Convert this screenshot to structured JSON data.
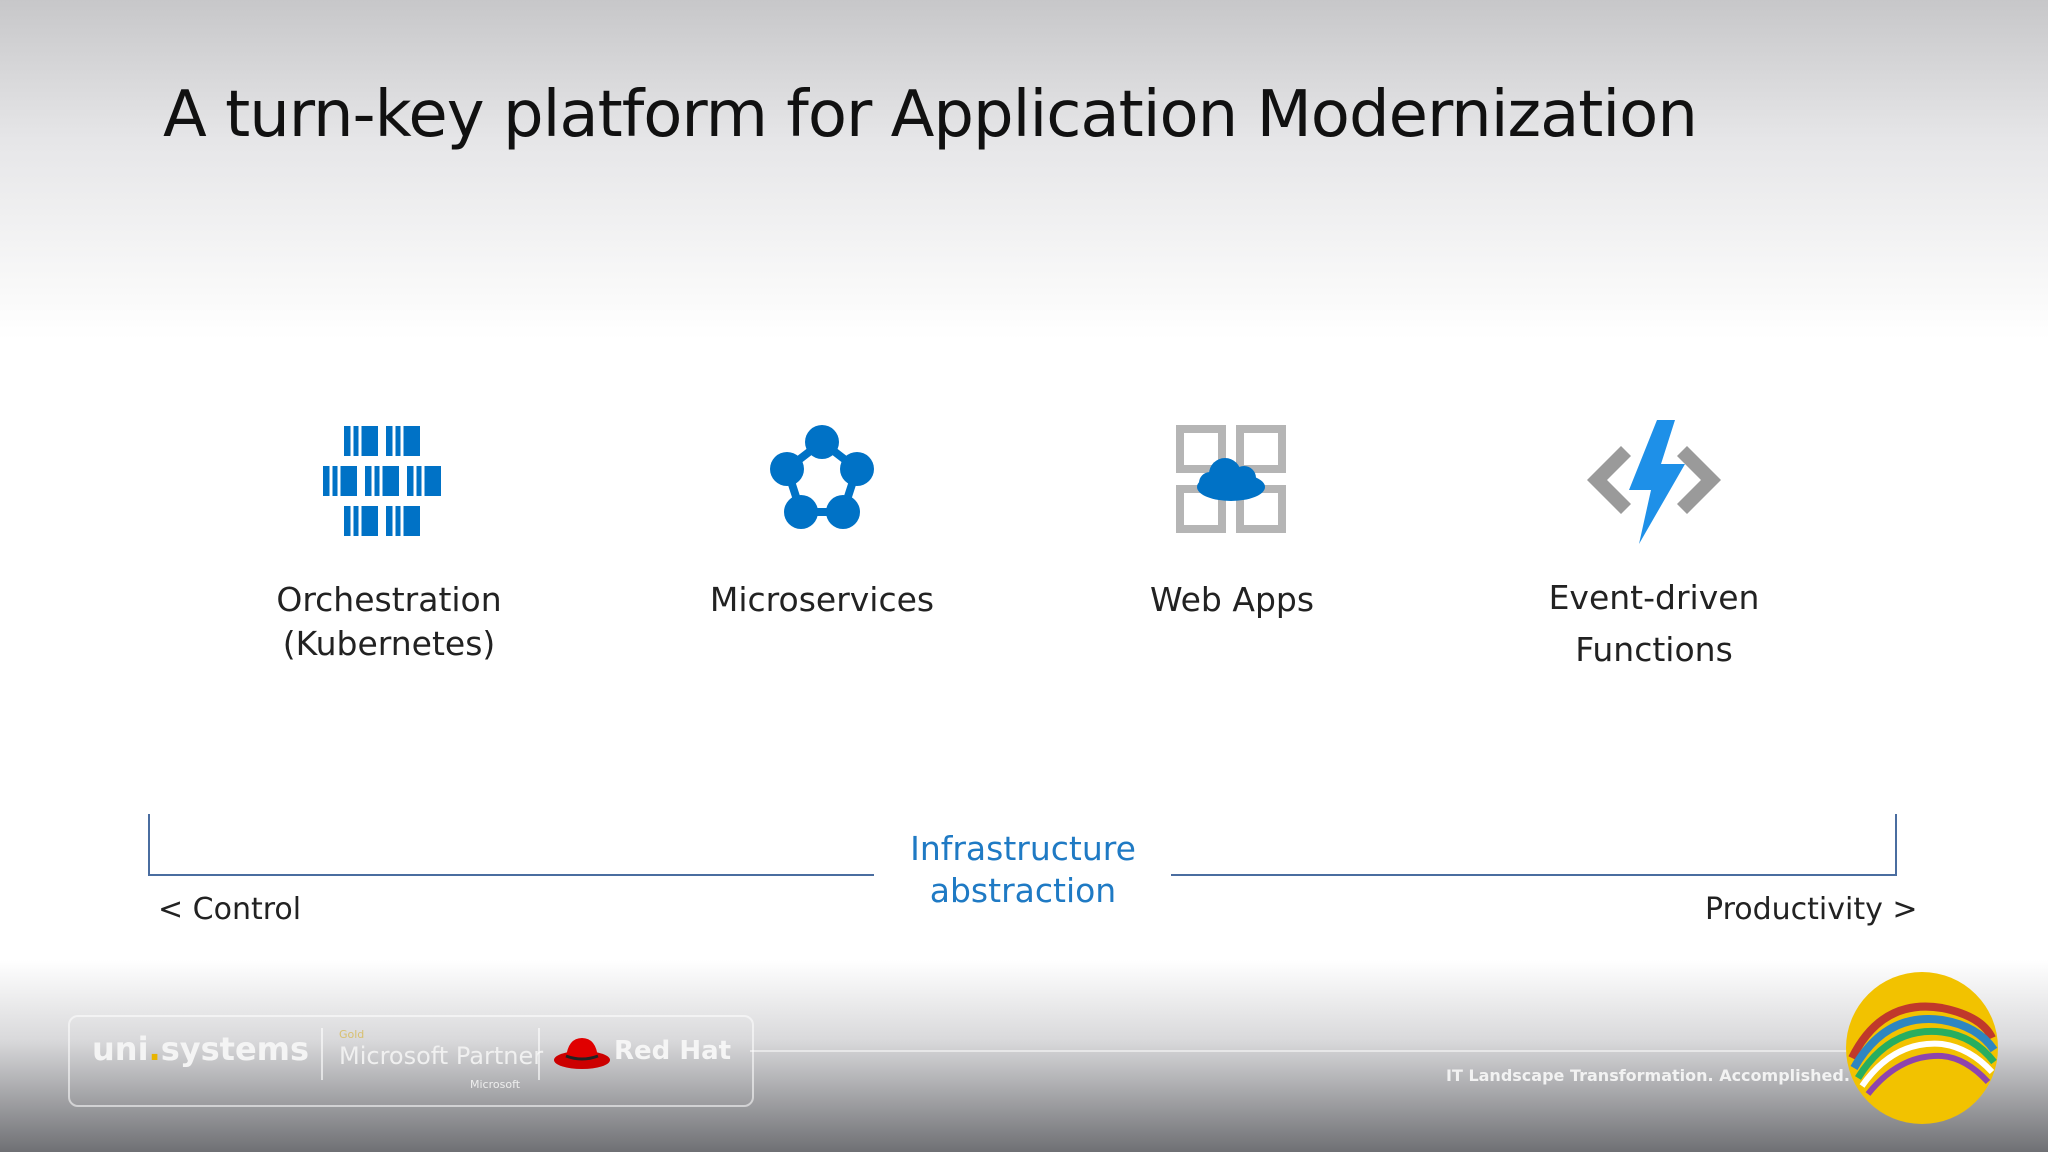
{
  "slide": {
    "title": "A turn-key platform for Application Modernization"
  },
  "features": [
    {
      "label_line1": "Orchestration",
      "label_line2": "(Kubernetes)",
      "icon": "kubernetes-containers-icon"
    },
    {
      "label_line1": "Microservices",
      "label_line2": "",
      "icon": "microservices-network-icon"
    },
    {
      "label_line1": "Web Apps",
      "label_line2": "",
      "icon": "web-app-cloud-icon"
    },
    {
      "label_line1": "Event-driven",
      "label_line2": "Functions",
      "icon": "functions-lightning-icon"
    }
  ],
  "axis": {
    "center_line1": "Infrastructure",
    "center_line2": "abstraction",
    "left_label": "< Control",
    "right_label": "Productivity >"
  },
  "footer": {
    "company": "uni",
    "company_suffix": "systems",
    "partner_level": "Gold",
    "partner_name": "Microsoft Partner",
    "partner_small": "Microsoft",
    "redhat": "Red Hat",
    "tagline": "IT Landscape Transformation. Accomplished."
  },
  "colors": {
    "azure_blue": "#0072c6",
    "axis_line": "#4a6da0",
    "axis_text": "#1f7ac4",
    "webapp_gray": "#b5b5b5"
  }
}
